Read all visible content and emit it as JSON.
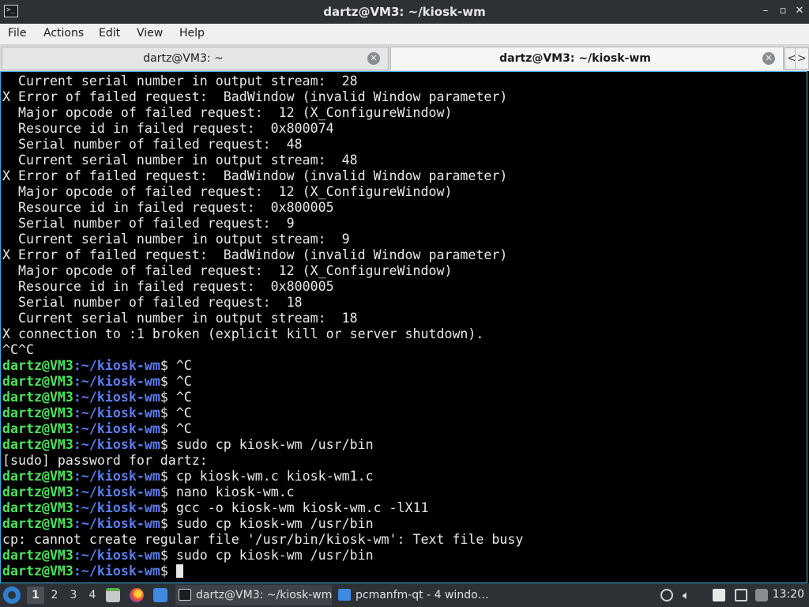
{
  "window": {
    "title": "dartz@VM3: ~/kiosk-wm",
    "app_icon_glyph": ">_",
    "controls": {
      "minimize": "–",
      "maximize": "▫",
      "close": "✕"
    }
  },
  "menubar": {
    "items": [
      "File",
      "Actions",
      "Edit",
      "View",
      "Help"
    ]
  },
  "tabs": [
    {
      "label": "dartz@VM3: ~",
      "active": false
    },
    {
      "label": "dartz@VM3: ~/kiosk-wm",
      "active": true
    }
  ],
  "tab_scroll": {
    "left": "<",
    "right": ">"
  },
  "terminal": {
    "prompt_user": "dartz@VM3",
    "prompt_path": ":~/kiosk-wm",
    "prompt_symbol": "$",
    "lines": [
      {
        "type": "out",
        "text": "  Current serial number in output stream:  28"
      },
      {
        "type": "out",
        "text": "X Error of failed request:  BadWindow (invalid Window parameter)"
      },
      {
        "type": "out",
        "text": "  Major opcode of failed request:  12 (X_ConfigureWindow)"
      },
      {
        "type": "out",
        "text": "  Resource id in failed request:  0x800074"
      },
      {
        "type": "out",
        "text": "  Serial number of failed request:  48"
      },
      {
        "type": "out",
        "text": "  Current serial number in output stream:  48"
      },
      {
        "type": "out",
        "text": "X Error of failed request:  BadWindow (invalid Window parameter)"
      },
      {
        "type": "out",
        "text": "  Major opcode of failed request:  12 (X_ConfigureWindow)"
      },
      {
        "type": "out",
        "text": "  Resource id in failed request:  0x800005"
      },
      {
        "type": "out",
        "text": "  Serial number of failed request:  9"
      },
      {
        "type": "out",
        "text": "  Current serial number in output stream:  9"
      },
      {
        "type": "out",
        "text": "X Error of failed request:  BadWindow (invalid Window parameter)"
      },
      {
        "type": "out",
        "text": "  Major opcode of failed request:  12 (X_ConfigureWindow)"
      },
      {
        "type": "out",
        "text": "  Resource id in failed request:  0x800005"
      },
      {
        "type": "out",
        "text": "  Serial number of failed request:  18"
      },
      {
        "type": "out",
        "text": "  Current serial number in output stream:  18"
      },
      {
        "type": "out",
        "text": "X connection to :1 broken (explicit kill or server shutdown)."
      },
      {
        "type": "out",
        "text": "^C^C"
      },
      {
        "type": "prompt",
        "cmd": " ^C"
      },
      {
        "type": "prompt",
        "cmd": " ^C"
      },
      {
        "type": "prompt",
        "cmd": " ^C"
      },
      {
        "type": "prompt",
        "cmd": " ^C"
      },
      {
        "type": "prompt",
        "cmd": " ^C"
      },
      {
        "type": "prompt",
        "cmd": " sudo cp kiosk-wm /usr/bin"
      },
      {
        "type": "out",
        "text": "[sudo] password for dartz:"
      },
      {
        "type": "prompt",
        "cmd": " cp kiosk-wm.c kiosk-wm1.c"
      },
      {
        "type": "prompt",
        "cmd": " nano kiosk-wm.c"
      },
      {
        "type": "prompt",
        "cmd": " gcc -o kiosk-wm kiosk-wm.c -lX11"
      },
      {
        "type": "prompt",
        "cmd": " sudo cp kiosk-wm /usr/bin"
      },
      {
        "type": "out",
        "text": "cp: cannot create regular file '/usr/bin/kiosk-wm': Text file busy"
      },
      {
        "type": "prompt",
        "cmd": " sudo cp kiosk-wm /usr/bin"
      },
      {
        "type": "prompt",
        "cmd": " ",
        "cursor": true
      }
    ]
  },
  "taskbar": {
    "desktops": [
      "1",
      "2",
      "3",
      "4"
    ],
    "tasks": [
      {
        "label": "dartz@VM3: ~/kiosk-wm",
        "active": true
      },
      {
        "label": "pcmanfm-qt - 4 windo…",
        "active": false
      }
    ],
    "clock": "13:20"
  },
  "colors": {
    "prompt_user": "#4ce25c",
    "prompt_path": "#5b7cf0",
    "accent": "#3daee9"
  }
}
